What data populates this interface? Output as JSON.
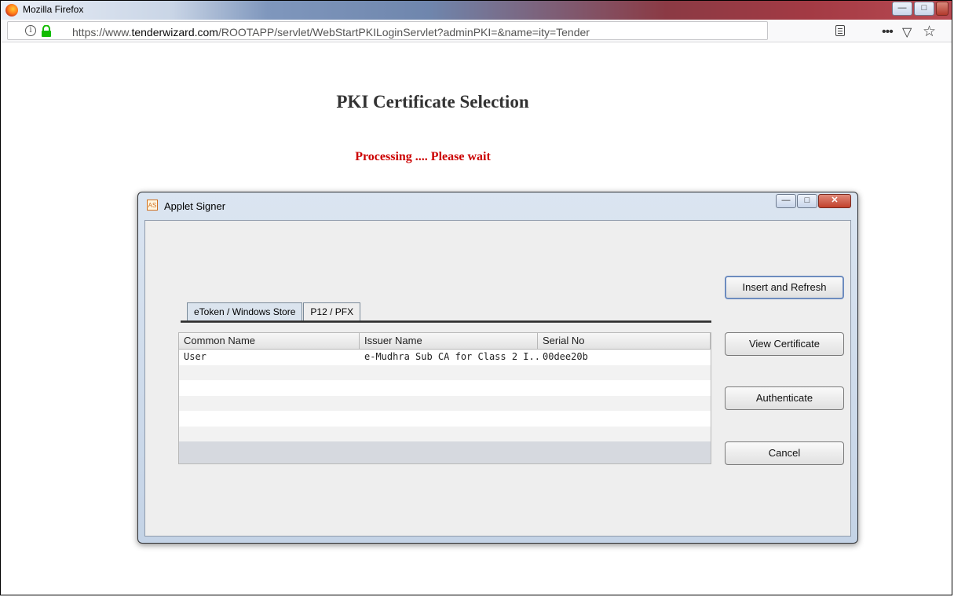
{
  "browser": {
    "window_title": "Mozilla Firefox",
    "url_prefix": "https://www.",
    "url_domain": "tenderwizard.com",
    "url_path": "/ROOTAPP/servlet/WebStartPKILoginServlet?adminPKI=&name=ity=Tender"
  },
  "page": {
    "title": "PKI Certificate Selection",
    "status": "Processing .... Please wait"
  },
  "dialog": {
    "title": "Applet Signer",
    "icon_text": "AS",
    "tabs": [
      {
        "label": "eToken / Windows Store",
        "active": true
      },
      {
        "label": "P12 / PFX",
        "active": false
      }
    ],
    "table": {
      "columns": [
        "Common Name",
        "Issuer Name",
        "Serial No"
      ],
      "rows": [
        {
          "common_name": "User",
          "issuer_name": "e-Mudhra Sub CA for Class 2 I...",
          "serial_no": "00dee20b"
        }
      ]
    },
    "buttons": {
      "insert_refresh": "Insert and Refresh",
      "view_certificate": "View Certificate",
      "authenticate": "Authenticate",
      "cancel": "Cancel"
    }
  },
  "colors": {
    "status_red": "#cc0000",
    "title_gray": "#333333"
  }
}
